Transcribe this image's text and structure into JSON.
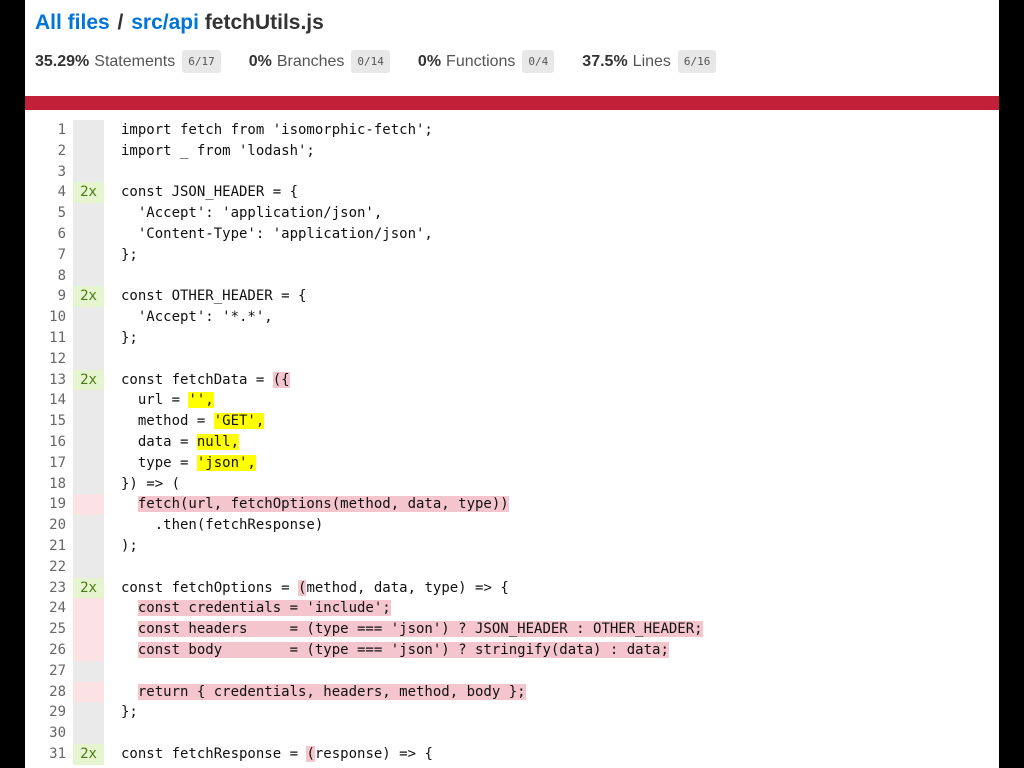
{
  "breadcrumb": {
    "all_files": "All files",
    "separator": "/",
    "dir": "src/api",
    "file": "fetchUtils.js"
  },
  "summary": [
    {
      "pct": "35.29%",
      "label": "Statements",
      "fraction": "6/17"
    },
    {
      "pct": "0%",
      "label": "Branches",
      "fraction": "0/14"
    },
    {
      "pct": "0%",
      "label": "Functions",
      "fraction": "0/4"
    },
    {
      "pct": "37.5%",
      "label": "Lines",
      "fraction": "6/16"
    }
  ],
  "colors": {
    "link": "#0074D9",
    "status_bar": "#C21F39",
    "uncovered_highlight": "#F4C5CC",
    "branch_highlight": "#FFFF00",
    "covered_gutter": "#e6f5d0"
  },
  "code_lines": [
    {
      "n": "1",
      "hits": "",
      "cov": "neutral",
      "segs": [
        [
          "import fetch from 'isomorphic-fetch';",
          ""
        ]
      ]
    },
    {
      "n": "2",
      "hits": "",
      "cov": "neutral",
      "segs": [
        [
          "import _ from 'lodash';",
          ""
        ]
      ]
    },
    {
      "n": "3",
      "hits": "",
      "cov": "neutral",
      "segs": [
        [
          "",
          ""
        ]
      ]
    },
    {
      "n": "4",
      "hits": "2x",
      "cov": "yes",
      "segs": [
        [
          "const JSON_HEADER = {",
          ""
        ]
      ]
    },
    {
      "n": "5",
      "hits": "",
      "cov": "neutral",
      "segs": [
        [
          "  'Accept': 'application/json',",
          ""
        ]
      ]
    },
    {
      "n": "6",
      "hits": "",
      "cov": "neutral",
      "segs": [
        [
          "  'Content-Type': 'application/json',",
          ""
        ]
      ]
    },
    {
      "n": "7",
      "hits": "",
      "cov": "neutral",
      "segs": [
        [
          "};",
          ""
        ]
      ]
    },
    {
      "n": "8",
      "hits": "",
      "cov": "neutral",
      "segs": [
        [
          "",
          ""
        ]
      ]
    },
    {
      "n": "9",
      "hits": "2x",
      "cov": "yes",
      "segs": [
        [
          "const OTHER_HEADER = {",
          ""
        ]
      ]
    },
    {
      "n": "10",
      "hits": "",
      "cov": "neutral",
      "segs": [
        [
          "  'Accept': '*.*',",
          ""
        ]
      ]
    },
    {
      "n": "11",
      "hits": "",
      "cov": "neutral",
      "segs": [
        [
          "};",
          ""
        ]
      ]
    },
    {
      "n": "12",
      "hits": "",
      "cov": "neutral",
      "segs": [
        [
          "",
          ""
        ]
      ]
    },
    {
      "n": "13",
      "hits": "2x",
      "cov": "yes",
      "segs": [
        [
          "const fetchData = ",
          ""
        ],
        [
          "({",
          "red"
        ]
      ]
    },
    {
      "n": "14",
      "hits": "",
      "cov": "neutral",
      "segs": [
        [
          "  url = ",
          ""
        ],
        [
          "'',",
          "yellow"
        ]
      ]
    },
    {
      "n": "15",
      "hits": "",
      "cov": "neutral",
      "segs": [
        [
          "  method = ",
          ""
        ],
        [
          "'GET',",
          "yellow"
        ]
      ]
    },
    {
      "n": "16",
      "hits": "",
      "cov": "neutral",
      "segs": [
        [
          "  data = ",
          ""
        ],
        [
          "null,",
          "yellow"
        ]
      ]
    },
    {
      "n": "17",
      "hits": "",
      "cov": "neutral",
      "segs": [
        [
          "  type = ",
          ""
        ],
        [
          "'json',",
          "yellow"
        ]
      ]
    },
    {
      "n": "18",
      "hits": "",
      "cov": "neutral",
      "segs": [
        [
          "}) => (",
          ""
        ]
      ]
    },
    {
      "n": "19",
      "hits": "",
      "cov": "no",
      "segs": [
        [
          "  ",
          ""
        ],
        [
          "fetch(url, fetchOptions(method, data, type))",
          "red"
        ]
      ]
    },
    {
      "n": "20",
      "hits": "",
      "cov": "neutral",
      "segs": [
        [
          "    .then(fetchResponse)",
          ""
        ]
      ]
    },
    {
      "n": "21",
      "hits": "",
      "cov": "neutral",
      "segs": [
        [
          ");",
          ""
        ]
      ]
    },
    {
      "n": "22",
      "hits": "",
      "cov": "neutral",
      "segs": [
        [
          "",
          ""
        ]
      ]
    },
    {
      "n": "23",
      "hits": "2x",
      "cov": "yes",
      "segs": [
        [
          "const fetchOptions = ",
          ""
        ],
        [
          "(",
          "red"
        ],
        [
          "method, data, type) => {",
          ""
        ]
      ]
    },
    {
      "n": "24",
      "hits": "",
      "cov": "no",
      "segs": [
        [
          "  ",
          ""
        ],
        [
          "const credentials = 'include';",
          "red"
        ]
      ]
    },
    {
      "n": "25",
      "hits": "",
      "cov": "no",
      "segs": [
        [
          "  ",
          ""
        ],
        [
          "const headers     = (type === 'json') ? JSON_HEADER : OTHER_HEADER;",
          "red"
        ]
      ]
    },
    {
      "n": "26",
      "hits": "",
      "cov": "no",
      "segs": [
        [
          "  ",
          ""
        ],
        [
          "const body        = (type === 'json') ? stringify(data) : data;",
          "red"
        ]
      ]
    },
    {
      "n": "27",
      "hits": "",
      "cov": "neutral",
      "segs": [
        [
          "",
          ""
        ]
      ]
    },
    {
      "n": "28",
      "hits": "",
      "cov": "no",
      "segs": [
        [
          "  ",
          ""
        ],
        [
          "return { credentials, headers, method, body };",
          "red"
        ]
      ]
    },
    {
      "n": "29",
      "hits": "",
      "cov": "neutral",
      "segs": [
        [
          "};",
          ""
        ]
      ]
    },
    {
      "n": "30",
      "hits": "",
      "cov": "neutral",
      "segs": [
        [
          "",
          ""
        ]
      ]
    },
    {
      "n": "31",
      "hits": "2x",
      "cov": "yes",
      "segs": [
        [
          "const fetchResponse = ",
          ""
        ],
        [
          "(",
          "red"
        ],
        [
          "response) => {",
          ""
        ]
      ]
    }
  ]
}
